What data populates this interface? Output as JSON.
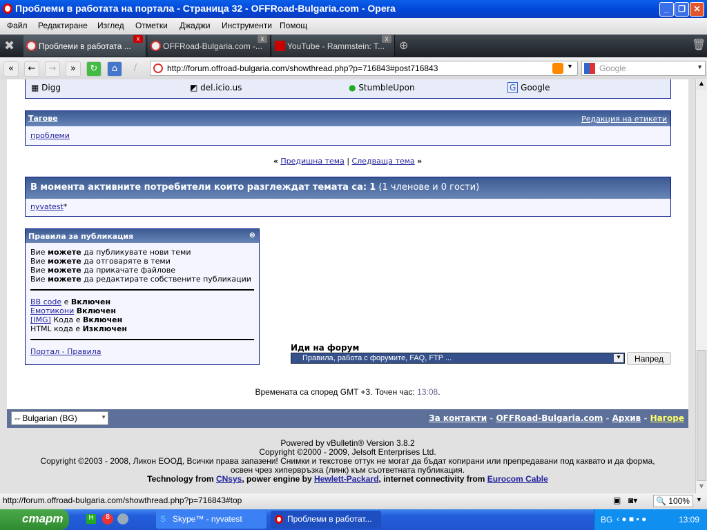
{
  "window": {
    "title": "Проблеми в работата на портала - Страница 32 - OFFRoad-Bulgaria.com - Opera"
  },
  "menu": [
    "Файл",
    "Редактиране",
    "Изглед",
    "Отметки",
    "Джаджи",
    "Инструменти",
    "Помощ"
  ],
  "tabs": [
    {
      "label": "Проблеми в работата ..."
    },
    {
      "label": "OFFRoad-Bulgaria.com -..."
    },
    {
      "label": "YouTube - Rammstein: T..."
    }
  ],
  "address": {
    "url": "http://forum.offroad-bulgaria.com/showthread.php?p=716843#post716843"
  },
  "search": {
    "placeholder": "Google"
  },
  "bookmarks": [
    "Digg",
    "del.icio.us",
    "StumbleUpon",
    "Google"
  ],
  "tags": {
    "title": "Тагове",
    "edit": "Редакция на етикети",
    "items": [
      "проблеми"
    ]
  },
  "threadnav": {
    "prev": "Предишна тема",
    "sep": "|",
    "next": "Следваща тема"
  },
  "active": {
    "title": "В момента активните потребители които разглеждат темата са:",
    "count": "1",
    "detail": "(1 членове и 0 гости)",
    "users": [
      "nyvatest"
    ],
    "suffix": "*"
  },
  "rules": {
    "title": "Правила за публикация",
    "perms": [
      {
        "pre": "Вие",
        "bold": "можете",
        "post": "да публикувате нови теми"
      },
      {
        "pre": "Вие",
        "bold": "можете",
        "post": "да отговаряте в теми"
      },
      {
        "pre": "Вие",
        "bold": "можете",
        "post": "да прикачате файлове"
      },
      {
        "pre": "Вие",
        "bold": "можете",
        "post": "да редактирате собствените публикации"
      }
    ],
    "bbcode": "BB code",
    "bbcode_post": "е",
    "on": "Включен",
    "smilies": "Емотикони",
    "img": "[IMG]",
    "img_post": "Кода е",
    "html": "HTML кода е",
    "off": "Изключен",
    "link": "Портал - Правила"
  },
  "forumjump": {
    "label": "Иди на форум",
    "selected": "Правила, работа с форумите, FAQ, FTP ...",
    "go": "Напред"
  },
  "time": {
    "text": "Времената са според GMT +3. Точен час:",
    "now": "13:08",
    "end": "."
  },
  "footer": {
    "lang": "-- Bulgarian (BG)",
    "links": [
      "За контакти",
      "OFFRoad-Bulgaria.com",
      "Архив",
      "Нагоре"
    ],
    "sep": "-"
  },
  "copyright": {
    "l1": "Powered by vBulletin® Version 3.8.2",
    "l2": "Copyright ©2000 - 2009, Jelsoft Enterprises Ltd.",
    "l3": "Copyright ©2003 - 2008, Ликон ЕООД, Всички права запазени! Снимки и текстове оттук не могат да бъдат копирани или препредавани под каквато и да форма,",
    "l4": "освен чрез хипервръзка (линк) към съответната публикация.",
    "t1": "Technology from",
    "cnsys": "CNsys",
    "t2": ", power engine by",
    "hp": "Hewlett-Packard",
    "t3": ", internet connectivity from",
    "euro": "Eurocom Cable"
  },
  "status": {
    "url": "http://forum.offroad-bulgaria.com/showthread.php?p=716843#top",
    "zoom": "100%"
  },
  "taskbar": {
    "start": "старт",
    "tasks": [
      "Skype™ - nyvatest",
      "Проблеми в работат..."
    ],
    "lang": "BG",
    "clock": "13:09"
  }
}
